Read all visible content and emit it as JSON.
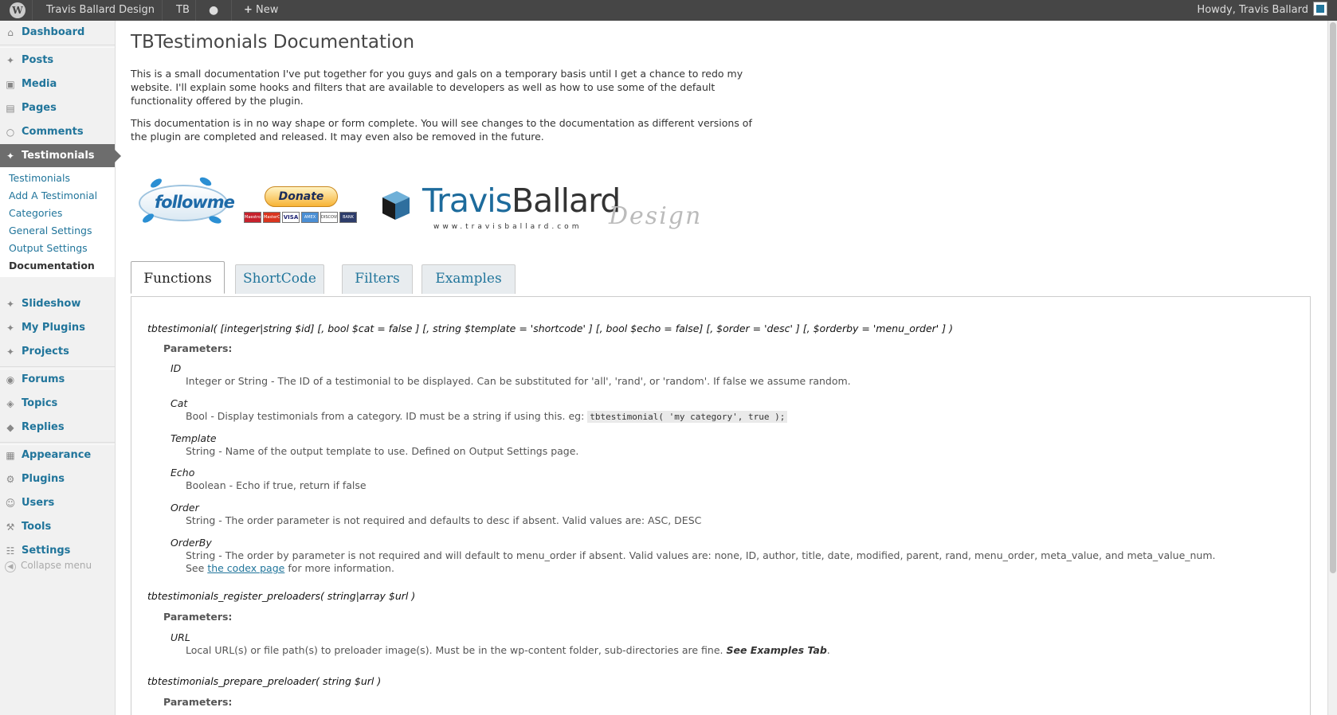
{
  "adminbar": {
    "site_name": "Travis Ballard Design",
    "tb": "TB",
    "new": "New",
    "howdy": "Howdy, Travis Ballard"
  },
  "sidebar": {
    "items": [
      {
        "label": "Dashboard",
        "icon": "home-icon"
      },
      {
        "label": "Posts",
        "icon": "pin-icon"
      },
      {
        "label": "Media",
        "icon": "media-icon"
      },
      {
        "label": "Pages",
        "icon": "pages-icon"
      },
      {
        "label": "Comments",
        "icon": "comment-icon"
      },
      {
        "label": "Testimonials",
        "icon": "pin-icon"
      },
      {
        "label": "Slideshow",
        "icon": "pin-icon"
      },
      {
        "label": "My Plugins",
        "icon": "pin-icon"
      },
      {
        "label": "Projects",
        "icon": "pin-icon"
      },
      {
        "label": "Forums",
        "icon": "forums-icon"
      },
      {
        "label": "Topics",
        "icon": "topics-icon"
      },
      {
        "label": "Replies",
        "icon": "replies-icon"
      },
      {
        "label": "Appearance",
        "icon": "appearance-icon"
      },
      {
        "label": "Plugins",
        "icon": "plugins-icon"
      },
      {
        "label": "Users",
        "icon": "users-icon"
      },
      {
        "label": "Tools",
        "icon": "tools-icon"
      },
      {
        "label": "Settings",
        "icon": "settings-icon"
      }
    ],
    "submenu": [
      "Testimonials",
      "Add A Testimonial",
      "Categories",
      "General Settings",
      "Output Settings",
      "Documentation"
    ],
    "collapse": "Collapse menu"
  },
  "page": {
    "title": "TBTestimonials Documentation",
    "intro1": "This is a small documentation I've put together for you guys and gals on a temporary basis until I get a chance to redo my website. I'll explain some hooks and filters that are available to developers as well as how to use some of the default functionality offered by the plugin.",
    "intro2": "This documentation is in no way shape or form complete. You will see changes to the documentation as different versions of the plugin are completed and released. It may even also be removed in the future."
  },
  "badges": {
    "followme": "followme",
    "donate": "Donate",
    "cards": [
      "Maestro",
      "MasterCard",
      "VISA",
      "AMEX",
      "DISCOVER",
      "BANK"
    ],
    "logo_part1": "Travis",
    "logo_part2": "Ballard",
    "logo_url": "www.travisballard.com",
    "logo_design": "Design"
  },
  "tabs": [
    "Functions",
    "ShortCode",
    "Filters",
    "Examples"
  ],
  "functions": {
    "f1_signature": "tbtestimonial( [integer|string $id] [, bool $cat = false ] [, string $template = 'shortcode' ] [, bool $echo = false] [, $order = 'desc' ] [, $orderby = 'menu_order' ] )",
    "params_label": "Parameters:",
    "f1_params": [
      {
        "name": "ID",
        "desc": "Integer or String - The ID of a testimonial to be displayed. Can be substituted for 'all', 'rand', or 'random'. If false we assume random."
      },
      {
        "name": "Cat",
        "desc": "Bool - Display testimonials from a category. ID must be a string if using this. eg:",
        "code": "tbtestimonial( 'my category', true );"
      },
      {
        "name": "Template",
        "desc": "String - Name of the output template to use. Defined on Output Settings page."
      },
      {
        "name": "Echo",
        "desc": "Boolean - Echo if true, return if false"
      },
      {
        "name": "Order",
        "desc": "String - The order parameter is not required and defaults to desc if absent. Valid values are: ASC, DESC"
      },
      {
        "name": "OrderBy",
        "desc": "String - The order by parameter is not required and will default to menu_order if absent. Valid values are: none, ID, author, title, date, modified, parent, rand, menu_order, meta_value, and meta_value_num.",
        "see_pre": "See",
        "link": "the codex page",
        "see_post": "for more information."
      }
    ],
    "f2_signature": "tbtestimonials_register_preloaders( string|array $url )",
    "f2_params": [
      {
        "name": "URL",
        "desc": "Local URL(s) or file path(s) to preloader image(s). Must be in the wp-content folder, sub-directories are fine.",
        "em": "See Examples Tab",
        "tail": "."
      }
    ],
    "f3_signature": "tbtestimonials_prepare_preloader( string $url )"
  }
}
